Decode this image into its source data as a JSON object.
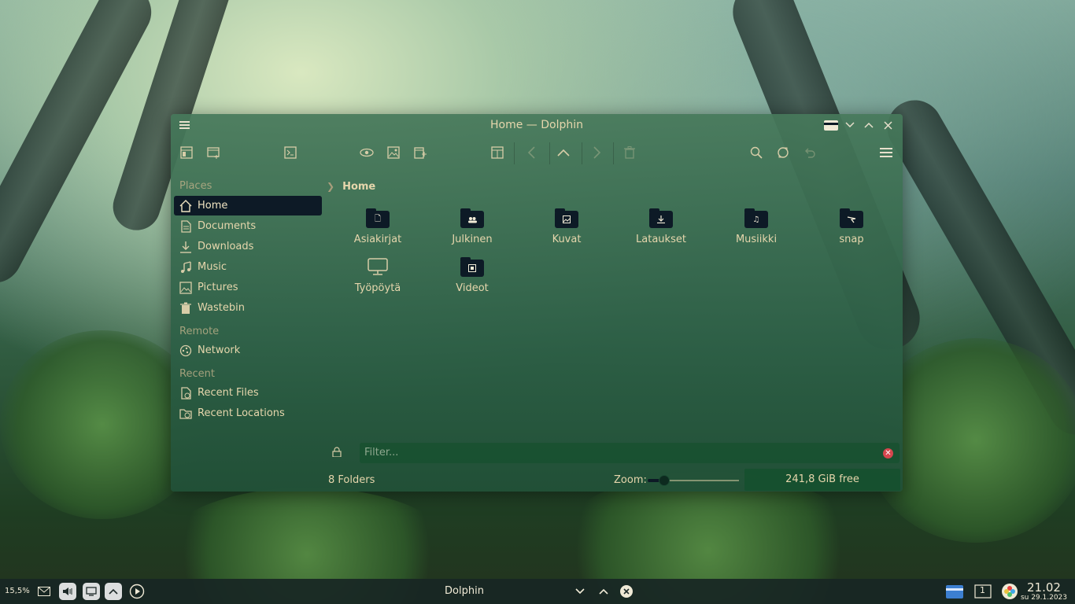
{
  "window": {
    "title": "Home — Dolphin",
    "toolbar": {
      "buttons": [
        "places-panel",
        "new-tab",
        "terminal",
        "preview",
        "image",
        "new-window",
        "split-view",
        "back",
        "up",
        "forward",
        "delete",
        "search",
        "refresh",
        "undo",
        "menu"
      ]
    },
    "sidebar": {
      "places_heading": "Places",
      "places": [
        {
          "label": "Home",
          "icon": "home-icon",
          "active": true
        },
        {
          "label": "Documents",
          "icon": "documents-icon"
        },
        {
          "label": "Downloads",
          "icon": "downloads-icon"
        },
        {
          "label": "Music",
          "icon": "music-icon"
        },
        {
          "label": "Pictures",
          "icon": "pictures-icon"
        },
        {
          "label": "Wastebin",
          "icon": "wastebin-icon"
        }
      ],
      "remote_heading": "Remote",
      "remote": [
        {
          "label": "Network",
          "icon": "network-icon"
        }
      ],
      "recent_heading": "Recent",
      "recent": [
        {
          "label": "Recent Files",
          "icon": "recent-files-icon"
        },
        {
          "label": "Recent Locations",
          "icon": "recent-locations-icon"
        }
      ]
    },
    "breadcrumb": {
      "current": "Home"
    },
    "items": [
      {
        "label": "Asiakirjat",
        "glyph": "document"
      },
      {
        "label": "Julkinen",
        "glyph": "people"
      },
      {
        "label": "Kuvat",
        "glyph": "image"
      },
      {
        "label": "Lataukset",
        "glyph": "download"
      },
      {
        "label": "Musiikki",
        "glyph": "music"
      },
      {
        "label": "snap",
        "glyph": "snap"
      },
      {
        "label": "Työpöytä",
        "glyph": "desktop"
      },
      {
        "label": "Videot",
        "glyph": "video"
      }
    ],
    "filter": {
      "placeholder": "Filter..."
    },
    "status": {
      "summary": "8 Folders",
      "zoom_label": "Zoom:",
      "zoom_level": 0.18,
      "free_space": "241,8 GiB free"
    }
  },
  "taskbar": {
    "cpu": "15,5%",
    "active_task": "Dolphin",
    "workspace": "1",
    "time": "21.02",
    "date": "su 29.1.2023"
  },
  "colors": {
    "accent_dark": "#0d1a26",
    "text": "#e6d6ac",
    "window_bg": "#2f5f46",
    "clear_button": "#d6464e"
  }
}
